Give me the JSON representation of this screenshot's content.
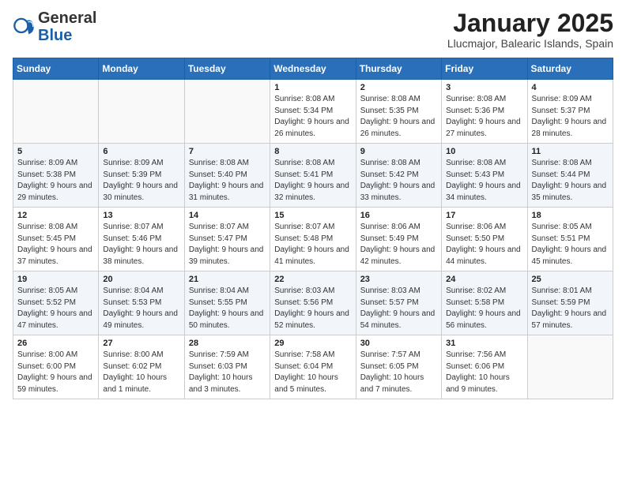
{
  "header": {
    "logo_general": "General",
    "logo_blue": "Blue",
    "month_title": "January 2025",
    "location": "Llucmajor, Balearic Islands, Spain"
  },
  "weekdays": [
    "Sunday",
    "Monday",
    "Tuesday",
    "Wednesday",
    "Thursday",
    "Friday",
    "Saturday"
  ],
  "weeks": [
    [
      {
        "day": "",
        "info": ""
      },
      {
        "day": "",
        "info": ""
      },
      {
        "day": "",
        "info": ""
      },
      {
        "day": "1",
        "info": "Sunrise: 8:08 AM\nSunset: 5:34 PM\nDaylight: 9 hours and 26 minutes."
      },
      {
        "day": "2",
        "info": "Sunrise: 8:08 AM\nSunset: 5:35 PM\nDaylight: 9 hours and 26 minutes."
      },
      {
        "day": "3",
        "info": "Sunrise: 8:08 AM\nSunset: 5:36 PM\nDaylight: 9 hours and 27 minutes."
      },
      {
        "day": "4",
        "info": "Sunrise: 8:09 AM\nSunset: 5:37 PM\nDaylight: 9 hours and 28 minutes."
      }
    ],
    [
      {
        "day": "5",
        "info": "Sunrise: 8:09 AM\nSunset: 5:38 PM\nDaylight: 9 hours and 29 minutes."
      },
      {
        "day": "6",
        "info": "Sunrise: 8:09 AM\nSunset: 5:39 PM\nDaylight: 9 hours and 30 minutes."
      },
      {
        "day": "7",
        "info": "Sunrise: 8:08 AM\nSunset: 5:40 PM\nDaylight: 9 hours and 31 minutes."
      },
      {
        "day": "8",
        "info": "Sunrise: 8:08 AM\nSunset: 5:41 PM\nDaylight: 9 hours and 32 minutes."
      },
      {
        "day": "9",
        "info": "Sunrise: 8:08 AM\nSunset: 5:42 PM\nDaylight: 9 hours and 33 minutes."
      },
      {
        "day": "10",
        "info": "Sunrise: 8:08 AM\nSunset: 5:43 PM\nDaylight: 9 hours and 34 minutes."
      },
      {
        "day": "11",
        "info": "Sunrise: 8:08 AM\nSunset: 5:44 PM\nDaylight: 9 hours and 35 minutes."
      }
    ],
    [
      {
        "day": "12",
        "info": "Sunrise: 8:08 AM\nSunset: 5:45 PM\nDaylight: 9 hours and 37 minutes."
      },
      {
        "day": "13",
        "info": "Sunrise: 8:07 AM\nSunset: 5:46 PM\nDaylight: 9 hours and 38 minutes."
      },
      {
        "day": "14",
        "info": "Sunrise: 8:07 AM\nSunset: 5:47 PM\nDaylight: 9 hours and 39 minutes."
      },
      {
        "day": "15",
        "info": "Sunrise: 8:07 AM\nSunset: 5:48 PM\nDaylight: 9 hours and 41 minutes."
      },
      {
        "day": "16",
        "info": "Sunrise: 8:06 AM\nSunset: 5:49 PM\nDaylight: 9 hours and 42 minutes."
      },
      {
        "day": "17",
        "info": "Sunrise: 8:06 AM\nSunset: 5:50 PM\nDaylight: 9 hours and 44 minutes."
      },
      {
        "day": "18",
        "info": "Sunrise: 8:05 AM\nSunset: 5:51 PM\nDaylight: 9 hours and 45 minutes."
      }
    ],
    [
      {
        "day": "19",
        "info": "Sunrise: 8:05 AM\nSunset: 5:52 PM\nDaylight: 9 hours and 47 minutes."
      },
      {
        "day": "20",
        "info": "Sunrise: 8:04 AM\nSunset: 5:53 PM\nDaylight: 9 hours and 49 minutes."
      },
      {
        "day": "21",
        "info": "Sunrise: 8:04 AM\nSunset: 5:55 PM\nDaylight: 9 hours and 50 minutes."
      },
      {
        "day": "22",
        "info": "Sunrise: 8:03 AM\nSunset: 5:56 PM\nDaylight: 9 hours and 52 minutes."
      },
      {
        "day": "23",
        "info": "Sunrise: 8:03 AM\nSunset: 5:57 PM\nDaylight: 9 hours and 54 minutes."
      },
      {
        "day": "24",
        "info": "Sunrise: 8:02 AM\nSunset: 5:58 PM\nDaylight: 9 hours and 56 minutes."
      },
      {
        "day": "25",
        "info": "Sunrise: 8:01 AM\nSunset: 5:59 PM\nDaylight: 9 hours and 57 minutes."
      }
    ],
    [
      {
        "day": "26",
        "info": "Sunrise: 8:00 AM\nSunset: 6:00 PM\nDaylight: 9 hours and 59 minutes."
      },
      {
        "day": "27",
        "info": "Sunrise: 8:00 AM\nSunset: 6:02 PM\nDaylight: 10 hours and 1 minute."
      },
      {
        "day": "28",
        "info": "Sunrise: 7:59 AM\nSunset: 6:03 PM\nDaylight: 10 hours and 3 minutes."
      },
      {
        "day": "29",
        "info": "Sunrise: 7:58 AM\nSunset: 6:04 PM\nDaylight: 10 hours and 5 minutes."
      },
      {
        "day": "30",
        "info": "Sunrise: 7:57 AM\nSunset: 6:05 PM\nDaylight: 10 hours and 7 minutes."
      },
      {
        "day": "31",
        "info": "Sunrise: 7:56 AM\nSunset: 6:06 PM\nDaylight: 10 hours and 9 minutes."
      },
      {
        "day": "",
        "info": ""
      }
    ]
  ]
}
